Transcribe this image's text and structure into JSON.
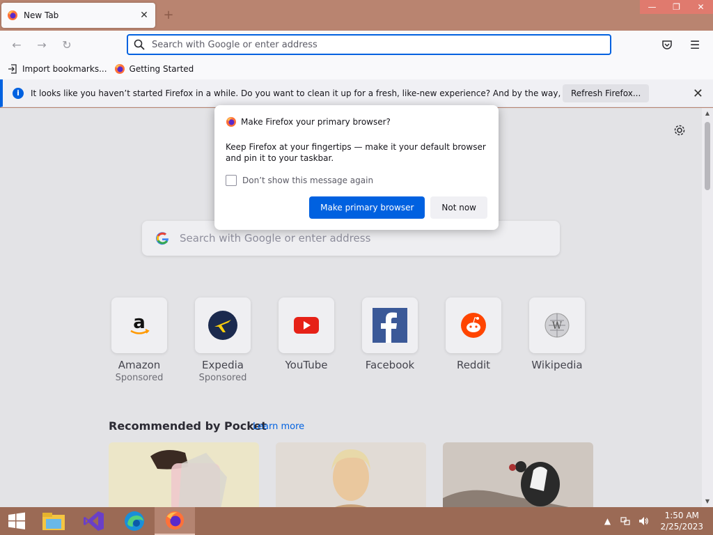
{
  "window": {
    "controls": {
      "minimize": "—",
      "restore": "❐",
      "close": "✕"
    }
  },
  "tab": {
    "title": "New Tab",
    "close": "✕",
    "icon": "firefox-logo"
  },
  "newtab": "+",
  "navbar": {
    "back": "←",
    "forward": "→",
    "reload": "↻",
    "url_placeholder": "Search with Google or enter address",
    "pocket": "pocket-icon",
    "menu": "☰"
  },
  "bookmarks": [
    {
      "label": "Import bookmarks...",
      "icon": "import-icon"
    },
    {
      "label": "Getting Started",
      "icon": "firefox-logo"
    }
  ],
  "notification": {
    "text": "It looks like you haven’t started Firefox in a while. Do you want to clean it up for a fresh, like-new experience? And by the way, welcome back!",
    "button": "Refresh Firefox...",
    "close": "✕"
  },
  "newtab_page": {
    "search_placeholder": "Search with Google or enter address",
    "tiles": [
      {
        "title": "Amazon",
        "sub": "Sponsored",
        "icon": "amazon-logo"
      },
      {
        "title": "Expedia",
        "sub": "Sponsored",
        "icon": "expedia-logo"
      },
      {
        "title": "YouTube",
        "sub": "",
        "icon": "youtube-logo"
      },
      {
        "title": "Facebook",
        "sub": "",
        "icon": "facebook-logo"
      },
      {
        "title": "Reddit",
        "sub": "",
        "icon": "reddit-logo"
      },
      {
        "title": "Wikipedia",
        "sub": "",
        "icon": "wikipedia-logo"
      }
    ],
    "pocket_title": "Recommended by Pocket",
    "pocket_learn_more": "Learn more"
  },
  "dialog": {
    "title": "Make Firefox your primary browser?",
    "body": "Keep Firefox at your fingertips — make it your default browser and pin it to your taskbar.",
    "checkbox_label": "Don’t show this message again",
    "primary_button": "Make primary browser",
    "secondary_button": "Not now"
  },
  "taskbar": {
    "apps": [
      "file-explorer",
      "visual-studio",
      "edge",
      "firefox"
    ],
    "time": "1:50 AM",
    "date": "2/25/2023"
  },
  "colors": {
    "accent": "#0061e0",
    "titlebar": "#b98470",
    "taskbar": "#9b6a55"
  }
}
